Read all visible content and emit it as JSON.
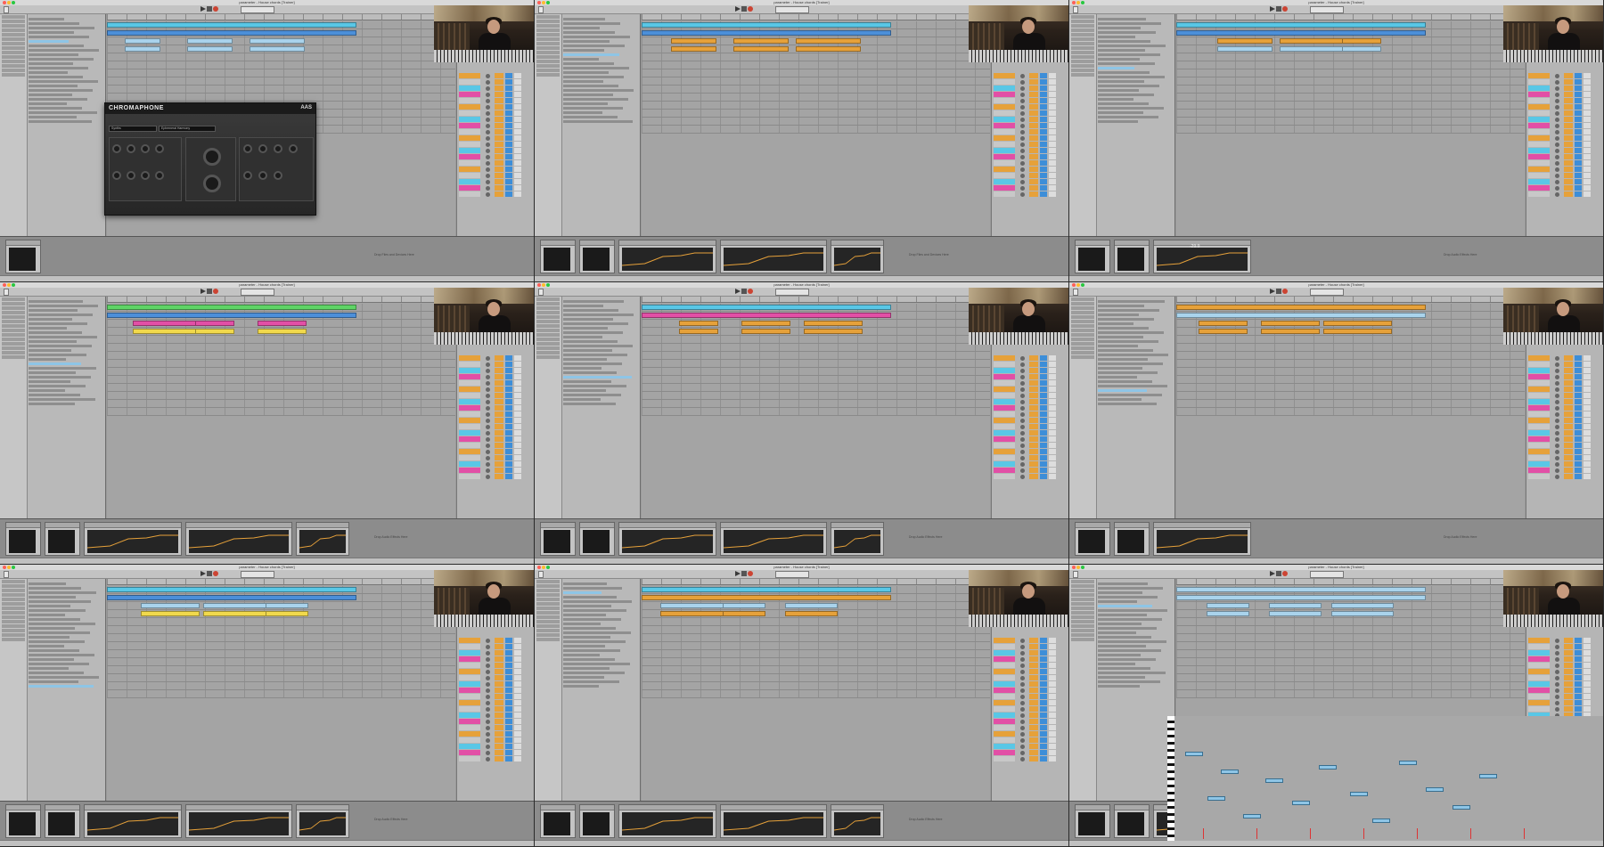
{
  "screen": {
    "title": "Ableton Live session video — 3×3 frame grid"
  },
  "window_title": "parameter - House chords  [Trainer]",
  "colors": {
    "clip_cyan": "#59c7e6",
    "clip_blue": "#4c8fd9",
    "clip_green": "#5fd466",
    "clip_pink": "#e24fa6",
    "clip_orange": "#e6a13a",
    "clip_yellow": "#f1d94c",
    "clip_lightblue": "#a9d3ec",
    "selected_row": "#8ec5e6",
    "plugin_bg": "#2e2e2e"
  },
  "plugin": {
    "title": "CHROMAPHONE",
    "brand": "AAS",
    "preset_bank": "Synths",
    "preset_name": "Ephemeral Harmony"
  },
  "frames": [
    {
      "id": "f1",
      "has_plugin": true,
      "drop_hint": "Drop Files and Devices Here"
    },
    {
      "id": "f2",
      "drop_hint": "Drop Files and Devices Here"
    },
    {
      "id": "f3",
      "meter_value": "-29.9",
      "drop_hint": "Drop Audio Effects Here"
    },
    {
      "id": "f4",
      "drop_hint": "Drop Audio Effects Here"
    },
    {
      "id": "f5",
      "drop_hint": "Drop Audio Effects Here"
    },
    {
      "id": "f6",
      "drop_hint": "Drop Audio Effects Here"
    },
    {
      "id": "f7",
      "drop_hint": "Drop Audio Effects Here"
    },
    {
      "id": "f8",
      "drop_hint": "Drop Audio Effects Here"
    },
    {
      "id": "f9",
      "drop_hint": "Drop Audio Effects Here"
    }
  ],
  "track_clip_colors": [
    [
      "clip_cyan",
      "clip_blue",
      "clip_lightblue",
      "clip_lightblue"
    ],
    [
      "clip_cyan",
      "clip_blue",
      "clip_orange",
      "clip_orange"
    ],
    [
      "clip_cyan",
      "clip_blue",
      "clip_orange",
      "clip_lightblue"
    ],
    [
      "clip_green",
      "clip_blue",
      "clip_pink",
      "clip_yellow"
    ],
    [
      "clip_cyan",
      "clip_pink",
      "clip_orange",
      "clip_orange"
    ],
    [
      "clip_orange",
      "clip_lightblue",
      "clip_orange",
      "clip_orange"
    ],
    [
      "clip_cyan",
      "clip_blue",
      "clip_lightblue",
      "clip_yellow"
    ],
    [
      "clip_cyan",
      "clip_orange",
      "clip_lightblue",
      "clip_orange"
    ],
    [
      "clip_lightblue",
      "clip_lightblue",
      "clip_lightblue",
      "clip_lightblue"
    ]
  ]
}
